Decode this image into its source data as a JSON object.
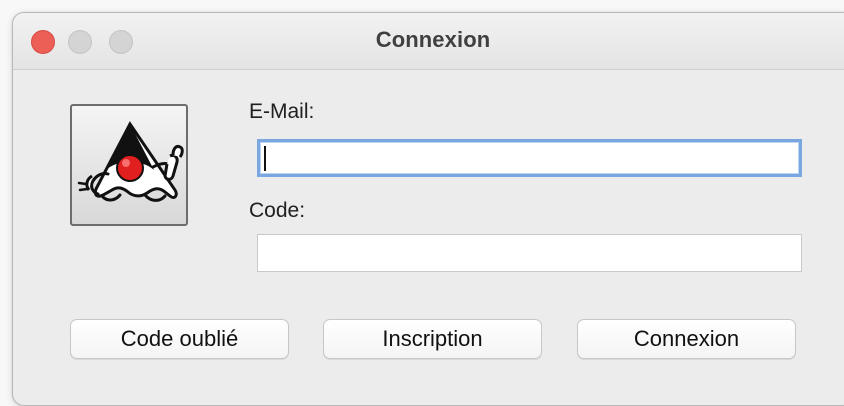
{
  "window": {
    "title": "Connexion",
    "controls": {
      "close_color": "#ec5f57",
      "minimize_color": "#d4d4d4",
      "maximize_color": "#d4d4d4"
    }
  },
  "logo": {
    "icon": "java-duke-icon"
  },
  "form": {
    "email_label": "E-Mail:",
    "email_value": "",
    "code_label": "Code:",
    "code_value": ""
  },
  "buttons": {
    "forgot_code": "Code oublié",
    "register": "Inscription",
    "login": "Connexion"
  }
}
